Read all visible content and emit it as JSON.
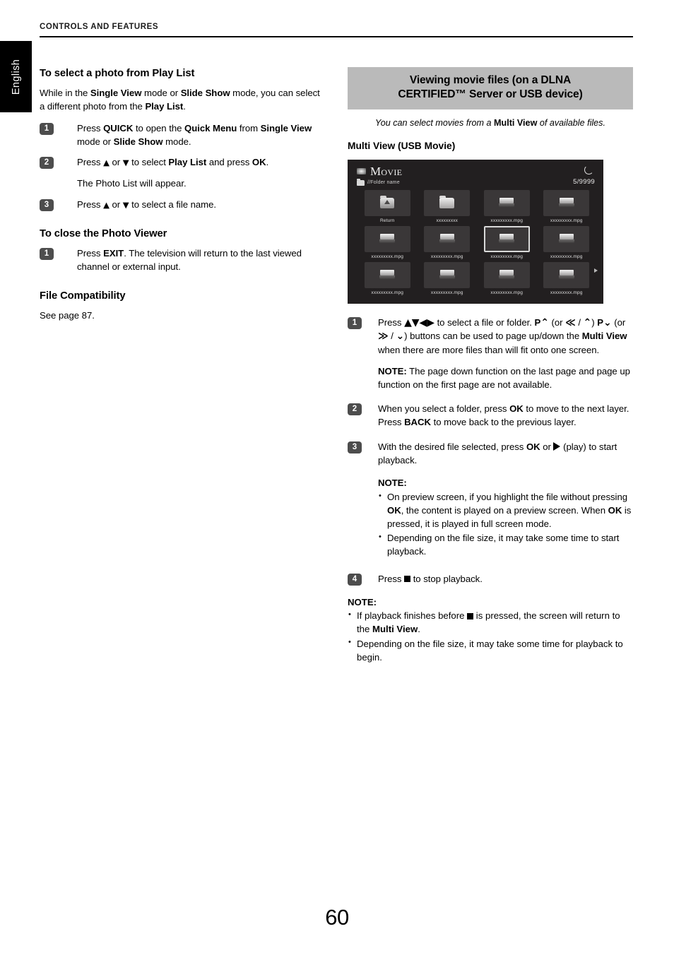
{
  "running_header": "CONTROLS AND FEATURES",
  "language_tab": "English",
  "page_number": "60",
  "left_column": {
    "heading_1": "To select a photo from Play List",
    "intro_1_a": "While in the ",
    "intro_1_b": "Single View",
    "intro_1_c": " mode or ",
    "intro_1_d": "Slide Show",
    "intro_1_e": " mode, you can select a different photo from the ",
    "intro_1_f": "Play List",
    "intro_1_g": ".",
    "step1_num": "1",
    "step1_a": "Press ",
    "step1_b": "QUICK",
    "step1_c": " to open the ",
    "step1_d": "Quick Menu",
    "step1_e": " from ",
    "step1_f": "Single View",
    "step1_g": " mode or ",
    "step1_h": "Slide Show",
    "step1_i": " mode.",
    "step2_num": "2",
    "step2_a": "Press ",
    "step2_up": "▲",
    "step2_b": " or ",
    "step2_down": "▼",
    "step2_c": " to select ",
    "step2_d": "Play List",
    "step2_e": " and press ",
    "step2_f": "OK",
    "step2_g": ".",
    "step2_cont": "The Photo List will appear.",
    "step3_num": "3",
    "step3_a": "Press ",
    "step3_up": "▲",
    "step3_b": " or ",
    "step3_down": "▼",
    "step3_c": " to select a file name.",
    "heading_2": "To close the Photo Viewer",
    "close_step1_num": "1",
    "close_step1_a": "Press ",
    "close_step1_b": "EXIT",
    "close_step1_c": ". The television will return to the last viewed channel or external input.",
    "heading_3": "File Compatibility",
    "file_compat_text": "See page 87."
  },
  "right_column": {
    "banner_line1": "Viewing movie files (on a DLNA",
    "banner_line2": "CERTIFIED™ Server or USB device)",
    "banner_sub_a": "You can select movies from a ",
    "banner_sub_b": "Multi View",
    "banner_sub_c": " of available files.",
    "subhead": "Multi View (USB Movie)",
    "tv_screen": {
      "title": "Movie",
      "usb_icon": "usb-device-icon",
      "path": "//Folder name",
      "refresh_icon": "refresh-icon",
      "counter": "5/9999",
      "next_page_arrow": "play-right-arrow-icon",
      "items": [
        {
          "icon": "return-folder-icon",
          "label": "Return",
          "selected": false
        },
        {
          "icon": "folder-icon",
          "label": "xxxxxxxxx",
          "selected": false
        },
        {
          "icon": "movie-file-icon",
          "label": "xxxxxxxxx.mpg",
          "selected": false
        },
        {
          "icon": "movie-file-icon",
          "label": "xxxxxxxxx.mpg",
          "selected": false
        },
        {
          "icon": "movie-file-icon",
          "label": "xxxxxxxxx.mpg",
          "selected": false
        },
        {
          "icon": "movie-file-icon",
          "label": "xxxxxxxxx.mpg",
          "selected": false
        },
        {
          "icon": "movie-file-icon",
          "label": "xxxxxxxxx.mpg",
          "selected": true
        },
        {
          "icon": "movie-file-icon",
          "label": "xxxxxxxxx.mpg",
          "selected": false
        },
        {
          "icon": "movie-file-icon",
          "label": "xxxxxxxxx.mpg",
          "selected": false
        },
        {
          "icon": "movie-file-icon",
          "label": "xxxxxxxxx.mpg",
          "selected": false
        },
        {
          "icon": "movie-file-icon",
          "label": "xxxxxxxxx.mpg",
          "selected": false
        },
        {
          "icon": "movie-file-icon",
          "label": "xxxxxxxxx.mpg",
          "selected": false
        }
      ]
    },
    "step1_num": "1",
    "step1_a": "Press ",
    "step1_arrows": "▲▼◀▶",
    "step1_b": " to select a file or folder. ",
    "step1_pup": "P",
    "step1_pup_glyph": "⌃",
    "step1_c": " (or ",
    "step1_g1": "≪",
    "step1_slash1": " / ",
    "step1_g2": "⌃",
    "step1_d": ") ",
    "step1_pdn": "P",
    "step1_pdn_glyph": "⌄",
    "step1_e": " (or ",
    "step1_g3": "≫",
    "step1_slash2": " / ",
    "step1_g4": "⌄",
    "step1_f": ") buttons can be used to page up/down the ",
    "step1_g": "Multi View",
    "step1_h": " when there are more files than will fit onto one screen.",
    "step1_note_label": "NOTE:",
    "step1_note_text": " The page down function on the last page and page up function on the first page are not available.",
    "step2_num": "2",
    "step2_a": "When you select a folder, press ",
    "step2_b": "OK",
    "step2_c": " to move to the next layer. Press ",
    "step2_d": "BACK",
    "step2_e": " to move back to the previous layer.",
    "step3_num": "3",
    "step3_a": "With the desired file selected, press ",
    "step3_b": "OK",
    "step3_c": " or ",
    "step3_play_icon": "play-icon",
    "step3_d": " (play) to start playback.",
    "step3_note_label": "NOTE:",
    "step3_note_1_a": "On preview screen, if you highlight the file without pressing ",
    "step3_note_1_b": "OK",
    "step3_note_1_c": ", the content is played on a preview screen. When ",
    "step3_note_1_d": "OK",
    "step3_note_1_e": " is pressed, it is played in full screen mode.",
    "step3_note_2": "Depending on the file size, it may take some time to start playback.",
    "step4_num": "4",
    "step4_a": "Press ",
    "step4_stop_icon": "stop-icon",
    "step4_b": " to stop playback.",
    "final_note_label": "NOTE:",
    "final_note_1_a": "If playback finishes before ",
    "final_note_1_stop": "stop-icon",
    "final_note_1_b": " is pressed, the screen will return to the ",
    "final_note_1_c": "Multi View",
    "final_note_1_d": ".",
    "final_note_2": "Depending on the file size, it may take some time for playback to begin."
  },
  "colors": {
    "banner_bg": "#bababa",
    "badge_bg": "#4d4d4d",
    "tv_bg": "#221f20",
    "tab_bg": "#000000"
  }
}
